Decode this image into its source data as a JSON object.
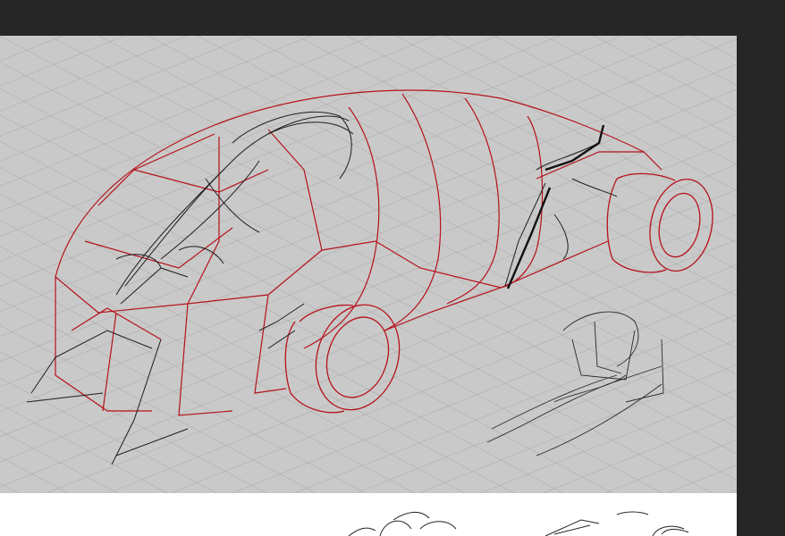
{
  "app": {
    "background_color": "#252525",
    "canvas_color": "#c9c9c9",
    "paper_color": "#ffffff"
  },
  "canvas": {
    "grid_color": "#aeaeae",
    "construction_color": "#b5121b",
    "sketch_color": "#1e1e1e"
  }
}
